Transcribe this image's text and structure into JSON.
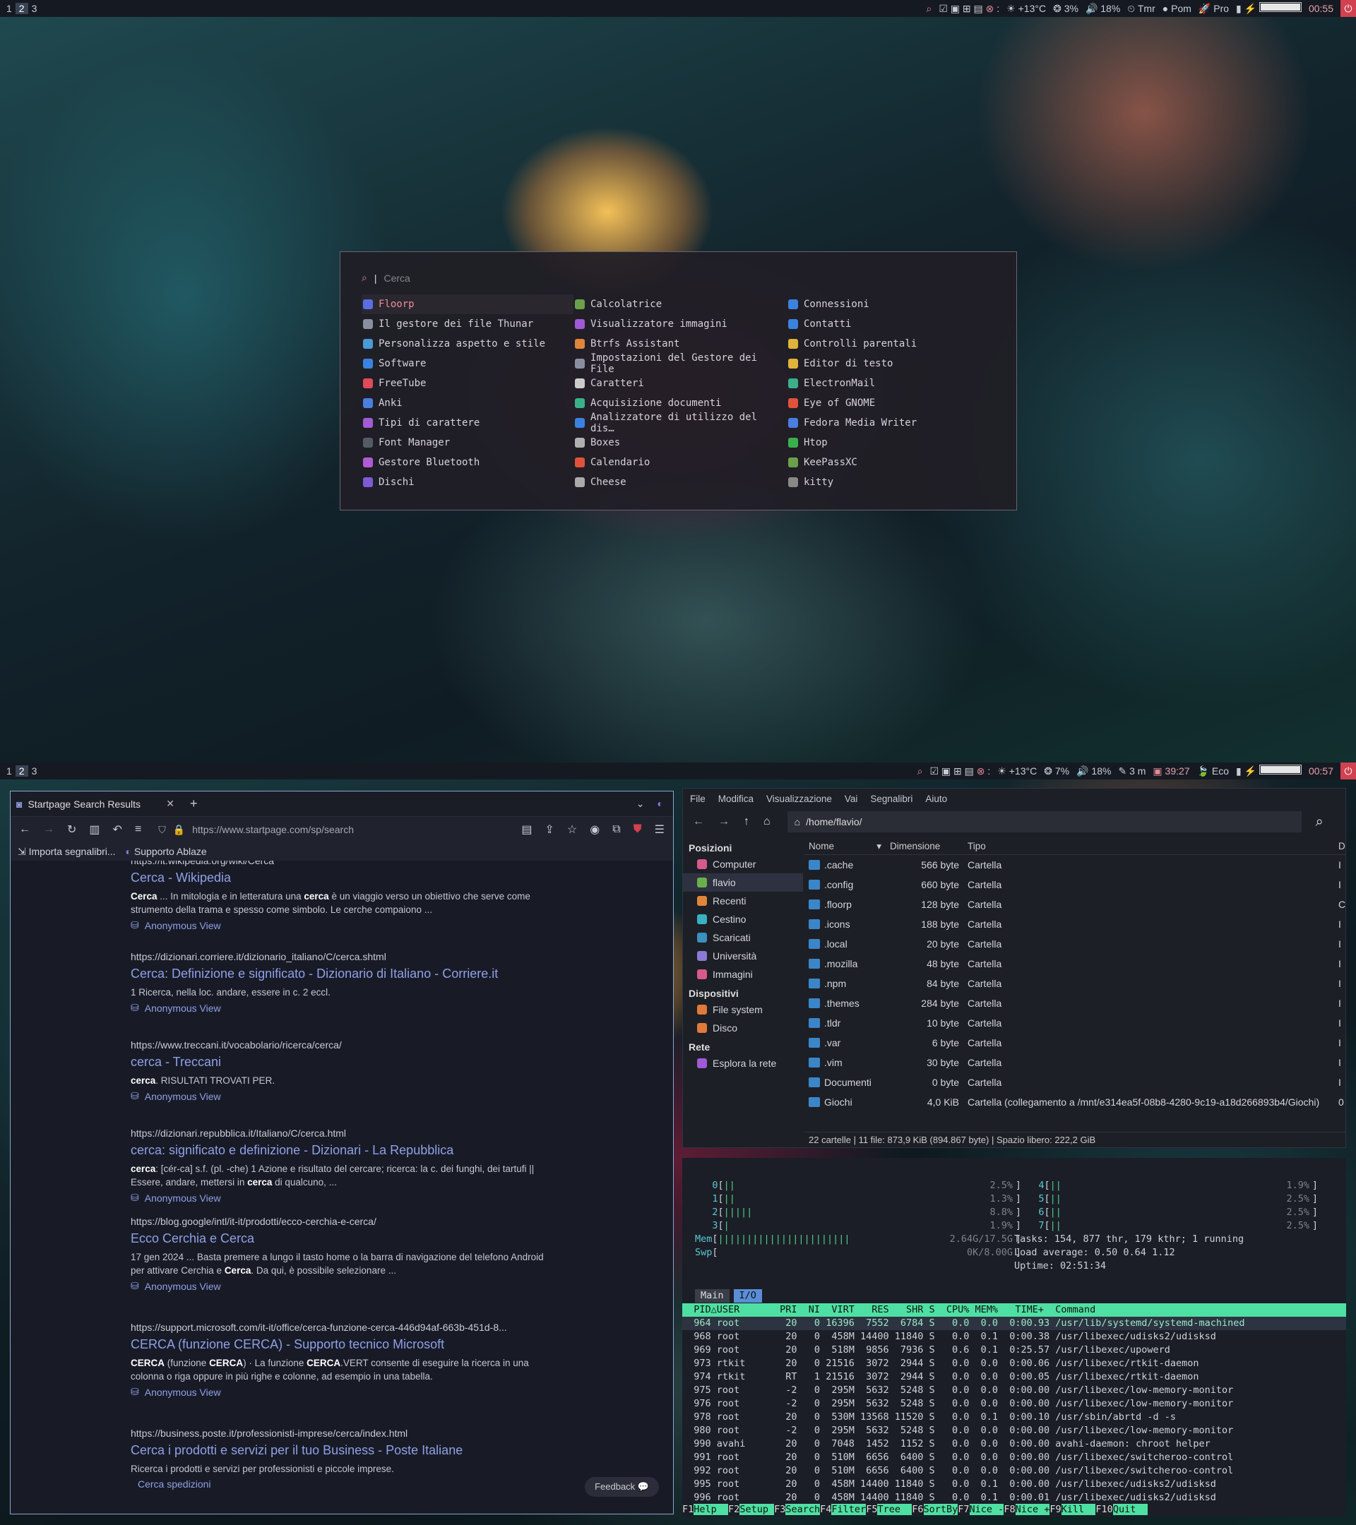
{
  "screen1": {
    "workspaces": [
      "1",
      "2",
      "3"
    ],
    "active_workspace": "2",
    "status": {
      "temp": "+13°C",
      "cpu": "3%",
      "volume": "18%",
      "timer": "Tmr",
      "pomodoro": "Pom",
      "profile": "Pro",
      "battery_level": 1.0,
      "clock": "00:55"
    },
    "launcher": {
      "search_placeholder": "Cerca",
      "columns": [
        [
          "Floorp",
          "Il gestore dei file Thunar",
          "Personalizza aspetto e stile",
          "Software",
          "FreeTube",
          "Anki",
          "Tipi di carattere",
          "Font Manager",
          "Gestore Bluetooth",
          "Dischi"
        ],
        [
          "Calcolatrice",
          "Visualizzatore immagini",
          "Btrfs Assistant",
          "Impostazioni del Gestore dei File",
          "Caratteri",
          "Acquisizione documenti",
          "Analizzatore di utilizzo del dis…",
          "Boxes",
          "Calendario",
          "Cheese"
        ],
        [
          "Connessioni",
          "Contatti",
          "Controlli parentali",
          "Editor di testo",
          "ElectronMail",
          "Eye of GNOME",
          "Fedora Media Writer",
          "Htop",
          "KeePassXC",
          "kitty"
        ]
      ],
      "icon_colors": [
        [
          "#5b6ee0",
          "#8a8fa0",
          "#4a9ad6",
          "#3b82e0",
          "#e04a5a",
          "#4a7ee0",
          "#a35ad6",
          "#555b66",
          "#b05ad6",
          "#7e5ad6"
        ],
        [
          "#6aa04a",
          "#a05ad6",
          "#e0863a",
          "#8a8fa0",
          "#cccccc",
          "#3ab08a",
          "#3b82e0",
          "#b0b0b0",
          "#e0523a",
          "#aaaaaa"
        ],
        [
          "#3b82e0",
          "#3b82e0",
          "#e0b43a",
          "#e0b43a",
          "#3ab08a",
          "#e0523a",
          "#4a7ee0",
          "#3ab04a",
          "#6aa04a",
          "#888888"
        ]
      ],
      "selected": "Floorp"
    }
  },
  "screen2": {
    "workspaces": [
      "1",
      "2",
      "3"
    ],
    "active_workspace": "2",
    "status": {
      "temp": "+13°C",
      "cpu": "7%",
      "volume": "18%",
      "edit": "3 m",
      "timer": "39:27",
      "profile": "Eco",
      "battery_level": 1.0,
      "clock": "00:57"
    },
    "browser": {
      "tab_title": "Startpage Search Results",
      "url": "https://www.startpage.com/sp/search",
      "bookmarks": [
        "Importa segnalibri...",
        "Supporto Ablaze"
      ],
      "clipped_top": "https://it.wikipedia.org/wiki/Cerca",
      "results": [
        {
          "url": "",
          "title": "Cerca - Wikipedia",
          "desc": [
            [
              "b",
              "Cerca"
            ],
            [
              "t",
              " ... In mitologia e in letteratura una "
            ],
            [
              "b",
              "cerca"
            ],
            [
              "t",
              " è un viaggio verso un obiettivo che serve come strumento della trama e spesso come simbolo. Le cerche compaiono ..."
            ]
          ]
        },
        {
          "url": "https://dizionari.corriere.it/dizionario_italiano/C/cerca.shtml",
          "title": "Cerca: Definizione e significato - Dizionario di Italiano - Corriere.it",
          "desc": [
            [
              "t",
              "1 Ricerca, nella loc. andare, essere in c. 2 eccl."
            ]
          ]
        },
        {
          "url": "https://www.treccani.it/vocabolario/ricerca/cerca/",
          "title": "cerca - Treccani",
          "desc": [
            [
              "b",
              "cerca"
            ],
            [
              "t",
              ". RISULTATI TROVATI PER."
            ]
          ]
        },
        {
          "url": "https://dizionari.repubblica.it/Italiano/C/cerca.html",
          "title": "cerca: significato e definizione - Dizionari - La Repubblica",
          "desc": [
            [
              "b",
              "cerca"
            ],
            [
              "t",
              ": [cér-ca] s.f. (pl. -che) 1 Azione e risultato del cercare; ricerca: la c. dei funghi, dei tartufi || Essere, andare, mettersi in "
            ],
            [
              "b",
              "cerca"
            ],
            [
              "t",
              " di qualcuno, ..."
            ]
          ]
        },
        {
          "url": "https://blog.google/intl/it-it/prodotti/ecco-cerchia-e-cerca/",
          "title": "Ecco Cerchia e Cerca",
          "desc": [
            [
              "t",
              "17 gen 2024 ... Basta premere a lungo il tasto home o la barra di navigazione del telefono Android per attivare Cerchia e "
            ],
            [
              "b",
              "Cerca"
            ],
            [
              "t",
              ". Da qui, è possibile selezionare ..."
            ]
          ]
        },
        {
          "url": "https://support.microsoft.com/it-it/office/cerca-funzione-cerca-446d94af-663b-451d-8...",
          "title": "CERCA (funzione CERCA) - Supporto tecnico Microsoft",
          "desc": [
            [
              "b",
              "CERCA"
            ],
            [
              "t",
              " (funzione "
            ],
            [
              "b",
              "CERCA"
            ],
            [
              "t",
              ") · La funzione "
            ],
            [
              "b",
              "CERCA"
            ],
            [
              "t",
              ".VERT consente di eseguire la ricerca in una colonna o riga oppure in più righe e colonne, ad esempio in una tabella."
            ]
          ]
        },
        {
          "url": "https://business.poste.it/professionisti-imprese/cerca/index.html",
          "title": "Cerca i prodotti e servizi per il tuo Business - Poste Italiane",
          "desc": [
            [
              "t",
              "Ricerca i prodotti e servizi per professionisti e piccole imprese."
            ]
          ]
        }
      ],
      "anonymous_view": "Anonymous View",
      "sub_link": "Cerca spedizioni",
      "feedback": "Feedback"
    },
    "filemanager": {
      "menu": [
        "File",
        "Modifica",
        "Visualizzazione",
        "Vai",
        "Segnalibri",
        "Aiuto"
      ],
      "path": "/home/flavio/",
      "sections": [
        {
          "title": "Posizioni",
          "items": [
            "Computer",
            "flavio",
            "Recenti",
            "Cestino",
            "Scaricati",
            "Università",
            "Immagini"
          ]
        },
        {
          "title": "Dispositivi",
          "items": [
            "File system",
            "Disco"
          ]
        },
        {
          "title": "Rete",
          "items": [
            "Esplora la rete"
          ]
        }
      ],
      "selected_place": "flavio",
      "columns": [
        "Nome",
        "Dimensione",
        "Tipo"
      ],
      "files": [
        [
          ".cache",
          "566 byte",
          "Cartella",
          "I"
        ],
        [
          ".config",
          "660 byte",
          "Cartella",
          "I"
        ],
        [
          ".floorp",
          "128 byte",
          "Cartella",
          "C"
        ],
        [
          ".icons",
          "188 byte",
          "Cartella",
          "I"
        ],
        [
          ".local",
          "20 byte",
          "Cartella",
          "I"
        ],
        [
          ".mozilla",
          "48 byte",
          "Cartella",
          "I"
        ],
        [
          ".npm",
          "84 byte",
          "Cartella",
          "I"
        ],
        [
          ".themes",
          "284 byte",
          "Cartella",
          "I"
        ],
        [
          ".tldr",
          "10 byte",
          "Cartella",
          "I"
        ],
        [
          ".var",
          "6 byte",
          "Cartella",
          "I"
        ],
        [
          ".vim",
          "30 byte",
          "Cartella",
          "I"
        ],
        [
          "Documenti",
          "0 byte",
          "Cartella",
          "I"
        ],
        [
          "Giochi",
          "4,0 KiB",
          "Cartella (collegamento a /mnt/e314ea5f-08b8-4280-9c19-a18d266893b4/Giochi)",
          "0"
        ]
      ],
      "statusbar": "22 cartelle  |  11 file: 873,9 KiB (894.867 byte)  |  Spazio libero: 222,2 GiB"
    },
    "htop": {
      "cpus_left": [
        [
          "0",
          "||",
          "2.5%"
        ],
        [
          "1",
          "||",
          "1.3%"
        ],
        [
          "2",
          "|||||",
          "8.8%"
        ],
        [
          "3",
          "|",
          "1.9%"
        ]
      ],
      "cpus_right": [
        [
          "4",
          "||",
          "1.9%"
        ],
        [
          "5",
          "||",
          "2.5%"
        ],
        [
          "6",
          "||",
          "2.5%"
        ],
        [
          "7",
          "||",
          "2.5%"
        ]
      ],
      "mem": "2.64G/17.5G",
      "swp": "0K/8.00G",
      "tasks": "Tasks: 154, 877 thr, 179 kthr; 1 running",
      "load": "Load average: 0.50 0.64 1.12",
      "uptime": "Uptime: 02:51:34",
      "tabs": [
        "Main",
        "I/O"
      ],
      "header": "  PID△USER       PRI  NI  VIRT   RES   SHR S  CPU% MEM%   TIME+  Command",
      "rows": [
        "  964 root        20   0 16396  7552  6784 S   0.0  0.0  0:00.93 /usr/lib/systemd/systemd-machined",
        "  968 root        20   0  458M 14400 11840 S   0.0  0.1  0:00.38 /usr/libexec/udisks2/udisksd",
        "  969 root        20   0  518M  9856  7936 S   0.6  0.1  0:25.57 /usr/libexec/upowerd",
        "  973 rtkit       20   0 21516  3072  2944 S   0.0  0.0  0:00.06 /usr/libexec/rtkit-daemon",
        "  974 rtkit       RT   1 21516  3072  2944 S   0.0  0.0  0:00.05 /usr/libexec/rtkit-daemon",
        "  975 root        -2   0  295M  5632  5248 S   0.0  0.0  0:00.00 /usr/libexec/low-memory-monitor",
        "  976 root        -2   0  295M  5632  5248 S   0.0  0.0  0:00.00 /usr/libexec/low-memory-monitor",
        "  978 root        20   0  530M 13568 11520 S   0.0  0.1  0:00.10 /usr/sbin/abrtd -d -s",
        "  980 root        -2   0  295M  5632  5248 S   0.0  0.0  0:00.00 /usr/libexec/low-memory-monitor",
        "  990 avahi       20   0  7048  1452  1152 S   0.0  0.0  0:00.00 avahi-daemon: chroot helper",
        "  991 root        20   0  510M  6656  6400 S   0.0  0.0  0:00.00 /usr/libexec/switcheroo-control",
        "  992 root        20   0  510M  6656  6400 S   0.0  0.0  0:00.00 /usr/libexec/switcheroo-control",
        "  995 root        20   0  458M 14400 11840 S   0.0  0.1  0:00.00 /usr/libexec/udisks2/udisksd",
        "  996 root        20   0  458M 14400 11840 S   0.0  0.1  0:00.01 /usr/libexec/udisks2/udisksd"
      ],
      "fkeys": [
        [
          "F1",
          "Help"
        ],
        [
          "F2",
          "Setup"
        ],
        [
          "F3",
          "Search"
        ],
        [
          "F4",
          "Filter"
        ],
        [
          "F5",
          "Tree"
        ],
        [
          "F6",
          "SortBy"
        ],
        [
          "F7",
          "Nice -"
        ],
        [
          "F8",
          "Nice +"
        ],
        [
          "F9",
          "Kill"
        ],
        [
          "F10",
          "Quit"
        ]
      ]
    }
  }
}
